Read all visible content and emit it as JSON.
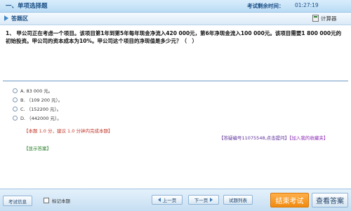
{
  "header": {
    "section_title": "一、单项选择题",
    "timer_label": "考试剩余时间：",
    "timer_value": "01:27:19"
  },
  "answer_area": {
    "label": "答题区",
    "calculator_label": "计算器"
  },
  "question": {
    "text": "1、 甲公司正在考虑一个项目。该项目第1年到第5年每年现金净流入420 000元，第6年净现金流入100 000元。该项目需要1 800 000元的初始投资。甲公司的资本成本为10%。甲公司这个项目的净现值是多少元？（　）"
  },
  "options": [
    {
      "label": "A. 83 000 元。"
    },
    {
      "label": "B. （109 200 元）。"
    },
    {
      "label": "C. （152200 元）。"
    },
    {
      "label": "D. （442000 元）。"
    }
  ],
  "score_note": "【本题 1.0 分，建议 1.0 分钟内完成本题】",
  "feedback": {
    "question_link": "【答疑编号11075548,点击提问】",
    "favorite": "【加入我的收藏夹】"
  },
  "show_answer": "【显示答案】",
  "footer": {
    "exam_info": "考试信息",
    "mark_label": "标记本题",
    "prev": "上一页",
    "next": "下一页",
    "question_list": "试题列表",
    "submit": "结束考试",
    "view_answers": "查看答案"
  },
  "colors": {
    "accent": "#1b4f86",
    "submit": "#f08a10",
    "score_note": "#c0392b",
    "feedback": "#5b2c9a",
    "show_answer": "#1f7a1f"
  }
}
